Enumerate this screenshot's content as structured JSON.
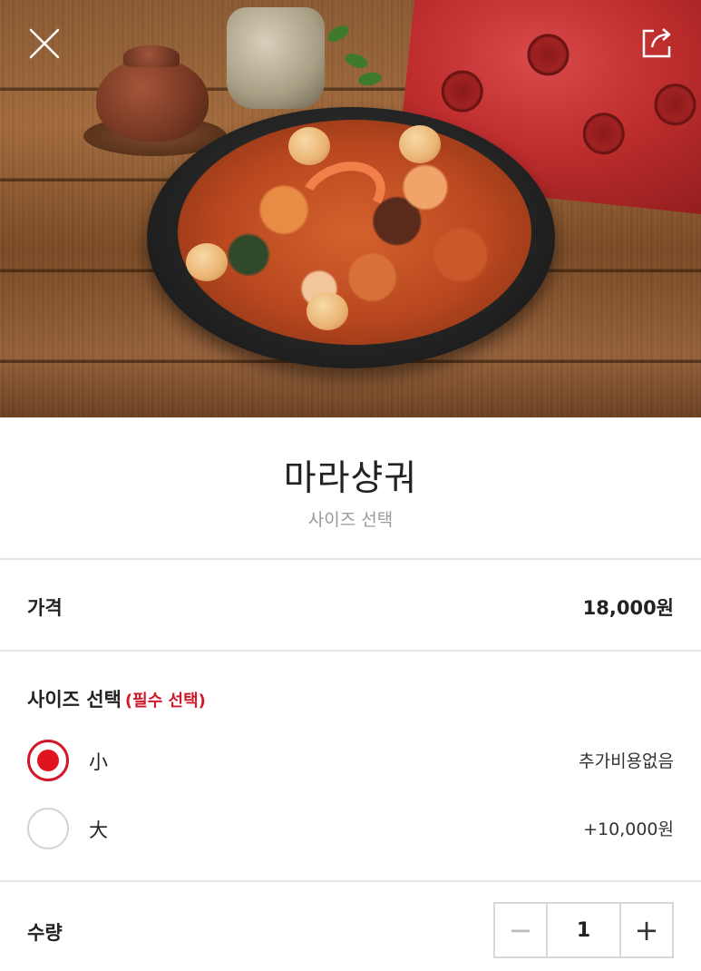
{
  "header": {
    "close_icon": "close-icon",
    "share_icon": "share-icon"
  },
  "menu": {
    "title": "마라샹궈",
    "subtitle": "사이즈 선택"
  },
  "price_row": {
    "label": "가격",
    "value": "18,000원"
  },
  "size_section": {
    "label": "사이즈 선택",
    "required": "(필수 선택)",
    "options": [
      {
        "label": "小",
        "price": "추가비용없음",
        "selected": true
      },
      {
        "label": "大",
        "price": "+10,000원",
        "selected": false
      }
    ]
  },
  "quantity": {
    "label": "수량",
    "value": "1",
    "minus": "−",
    "plus": "+"
  },
  "colors": {
    "accent": "#d1182a",
    "radio_fill": "#e0141f",
    "divider": "#e6e6e6"
  }
}
